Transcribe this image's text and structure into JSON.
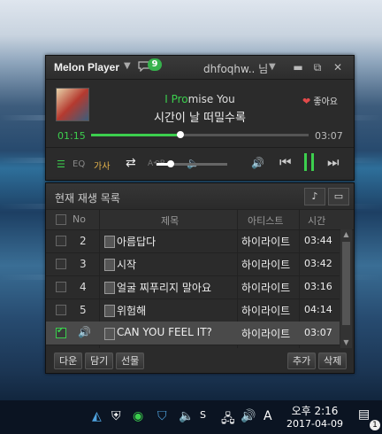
{
  "player": {
    "app_name": "Melon Player",
    "chat_badge": "9",
    "user_name": "dhfoqhw.. 님",
    "song": {
      "title_highlight": "I Pro",
      "title_rest": "mise You",
      "subtitle": "시간이 날 떠밀수록"
    },
    "like_label": "좋아요",
    "time_current": "01:15",
    "time_total": "03:07",
    "progress_fraction": 0.41,
    "volume_fraction": 0.2,
    "controls": {
      "eq": "EQ",
      "lyrics": "가사",
      "ab": "A⟲B"
    }
  },
  "playlist": {
    "title": "현재 재생 목록",
    "columns": {
      "no": "No",
      "title": "제목",
      "artist": "아티스트",
      "time": "시간"
    },
    "rows": [
      {
        "no": "2",
        "title": "아름답다",
        "artist": "하이라이트",
        "time": "03:44",
        "checked": false,
        "playing": false
      },
      {
        "no": "3",
        "title": "시작",
        "artist": "하이라이트",
        "time": "03:42",
        "checked": false,
        "playing": false
      },
      {
        "no": "4",
        "title": "얼굴 찌푸리지 말아요",
        "artist": "하이라이트",
        "time": "03:16",
        "checked": false,
        "playing": false
      },
      {
        "no": "5",
        "title": "위험해",
        "artist": "하이라이트",
        "time": "04:14",
        "checked": false,
        "playing": false
      },
      {
        "no": "",
        "title": "CAN YOU FEEL IT?",
        "artist": "하이라이트",
        "time": "03:07",
        "checked": true,
        "playing": true
      }
    ],
    "buttons": {
      "download": "다운",
      "add_to": "담기",
      "gift": "선물",
      "add": "추가",
      "delete": "삭제"
    }
  },
  "taskbar": {
    "ime": "A",
    "time": "오후 2:16",
    "date": "2017-04-09",
    "notification_count": "1"
  },
  "colors": {
    "accent_green": "#3ccf4e",
    "heart_red": "#e24a4a"
  }
}
